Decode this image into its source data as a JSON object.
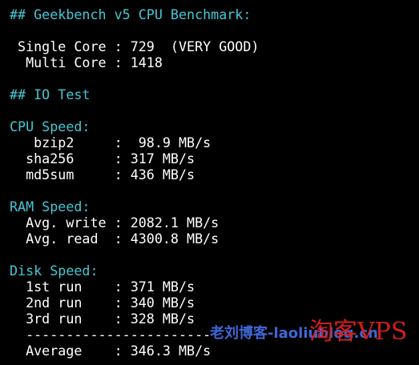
{
  "terminal": {
    "geekbench_header": "## Geekbench v5 CPU Benchmark:",
    "single_core": " Single Core : 729  (VERY GOOD)",
    "multi_core": "  Multi Core : 1418",
    "io_header": "## IO Test",
    "cpu_speed_label": "CPU Speed:",
    "bzip2": "   bzip2     :  98.9 MB/s",
    "sha256": "  sha256     : 317 MB/s",
    "md5sum": "  md5sum     : 436 MB/s",
    "ram_speed_label": "RAM Speed:",
    "avg_write": "  Avg. write : 2082.1 MB/s",
    "avg_read": "  Avg. read  : 4300.8 MB/s",
    "disk_speed_label": "Disk Speed:",
    "run_1": "  1st run    : 371 MB/s",
    "run_2": "  2nd run    : 340 MB/s",
    "run_3": "  3rd run    : 328 MB/s",
    "separator": "  -----------------------",
    "average": "  Average    : 346.3 MB/s"
  },
  "watermark": {
    "site_text": "老刘博客-laoliublog.cn",
    "brand_text": "淘客VPS"
  },
  "colors": {
    "background": "#000000",
    "heading_cyan": "#41c9d6",
    "text_white": "#ffffff",
    "watermark_blue": "#3f67d6",
    "watermark_red": "#d21e1e"
  }
}
